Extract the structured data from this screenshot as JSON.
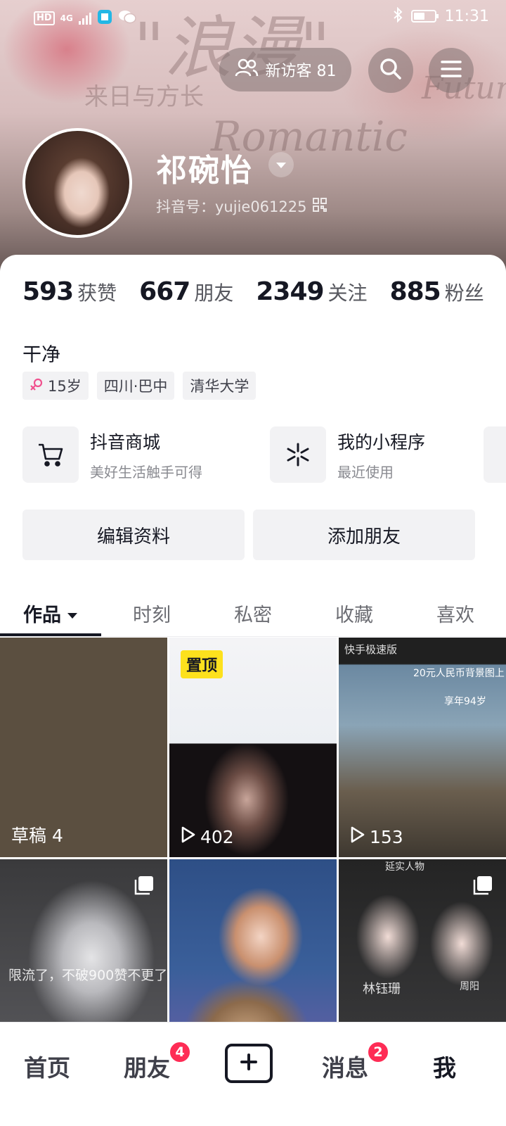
{
  "status_bar": {
    "network_chip": "HD",
    "network_type": "4G",
    "time": "11:31",
    "battery_level": 0.55
  },
  "header": {
    "visitors_label": "新访客 81",
    "cover_texts": [
      "\"浪漫\"",
      "Romantic",
      "Future",
      "来日与方长"
    ]
  },
  "profile": {
    "name": "祁碗怡",
    "douyin_id": "抖音号：yujie061225",
    "bio": "干净"
  },
  "stats": [
    {
      "num": "593",
      "label": "获赞"
    },
    {
      "num": "667",
      "label": "朋友"
    },
    {
      "num": "2349",
      "label": "关注"
    },
    {
      "num": "885",
      "label": "粉丝"
    }
  ],
  "tags": [
    {
      "text": "15岁",
      "icon": "female-symbol-icon"
    },
    {
      "text": "四川·巴中"
    },
    {
      "text": "清华大学"
    }
  ],
  "services": [
    {
      "title": "抖音商城",
      "sub": "美好生活触手可得",
      "icon": "cart-icon"
    },
    {
      "title": "我的小程序",
      "sub": "最近使用",
      "icon": "mini-program-icon"
    }
  ],
  "actions": {
    "edit": "编辑资料",
    "add_friend": "添加朋友"
  },
  "tabs": [
    {
      "label": "作品",
      "active": true
    },
    {
      "label": "时刻"
    },
    {
      "label": "私密"
    },
    {
      "label": "收藏"
    },
    {
      "label": "喜欢"
    }
  ],
  "grid": [
    {
      "label": "草稿 4"
    },
    {
      "badge": "置顶",
      "plays": "402"
    },
    {
      "plays": "153",
      "caption_top": "快手极速版",
      "caption_a": "20元人民币背景图上",
      "caption_b": "享年94岁"
    },
    {
      "caption": "限流了，不破900赞不更了",
      "multi": true
    },
    {},
    {
      "caption_top": "延实人物",
      "caption_a": "林钰珊",
      "caption_b": "周阳",
      "multi": true
    }
  ],
  "bottom_nav": {
    "home": "首页",
    "friends": "朋友",
    "friends_badge": "4",
    "messages": "消息",
    "messages_badge": "2",
    "me": "我"
  },
  "colors": {
    "accent": "#fe2c55",
    "pin_badge": "#fde11d",
    "text_primary": "#161823",
    "chip_bg": "#f2f2f4"
  }
}
